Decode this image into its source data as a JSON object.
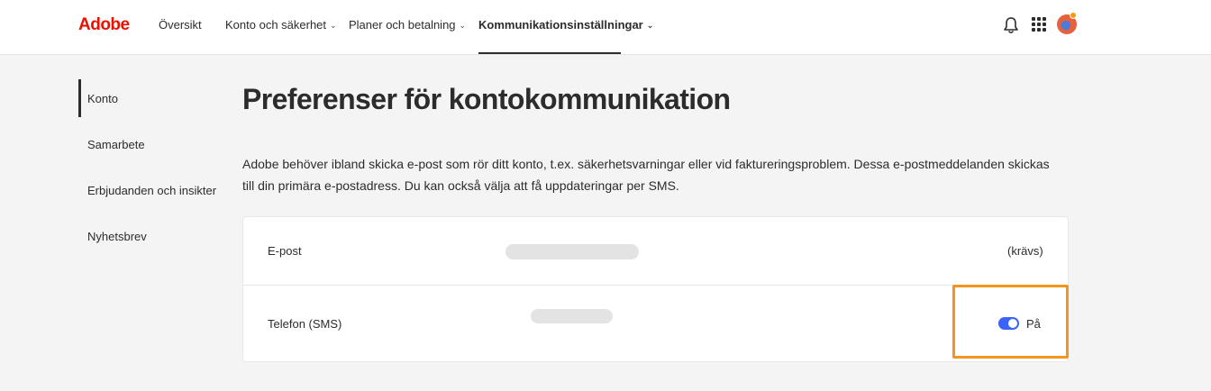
{
  "header": {
    "logo": "Adobe",
    "nav": [
      {
        "label": "Översikt",
        "has_menu": false
      },
      {
        "label": "Konto och säkerhet",
        "has_menu": true
      },
      {
        "label": "Planer och betalning",
        "has_menu": true
      },
      {
        "label": "Kommunikationsinställningar",
        "has_menu": true,
        "active": true
      }
    ],
    "icons": [
      "bell-icon",
      "app-grid-icon",
      "avatar"
    ]
  },
  "sidebar": {
    "items": [
      {
        "label": "Konto",
        "selected": true
      },
      {
        "label": "Samarbete"
      },
      {
        "label": "Erbjudanden och insikter"
      },
      {
        "label": "Nyhetsbrev"
      }
    ]
  },
  "main": {
    "title": "Preferenser för kontokommunikation",
    "description": "Adobe behöver ibland skicka e-post som rör ditt konto, t.ex. säkerhetsvarningar eller vid faktureringsproblem. Dessa e-postmeddelanden skickas till din primära e-postadress. Du kan också välja att få uppdateringar per SMS.",
    "rows": [
      {
        "label": "E-post",
        "status": "(krävs)"
      },
      {
        "label": "Telefon (SMS)",
        "toggle_on": true,
        "toggle_label": "På"
      }
    ]
  },
  "colors": {
    "brand": "#eb1000",
    "toggle": "#3b63fb",
    "highlight": "#f5941f"
  }
}
